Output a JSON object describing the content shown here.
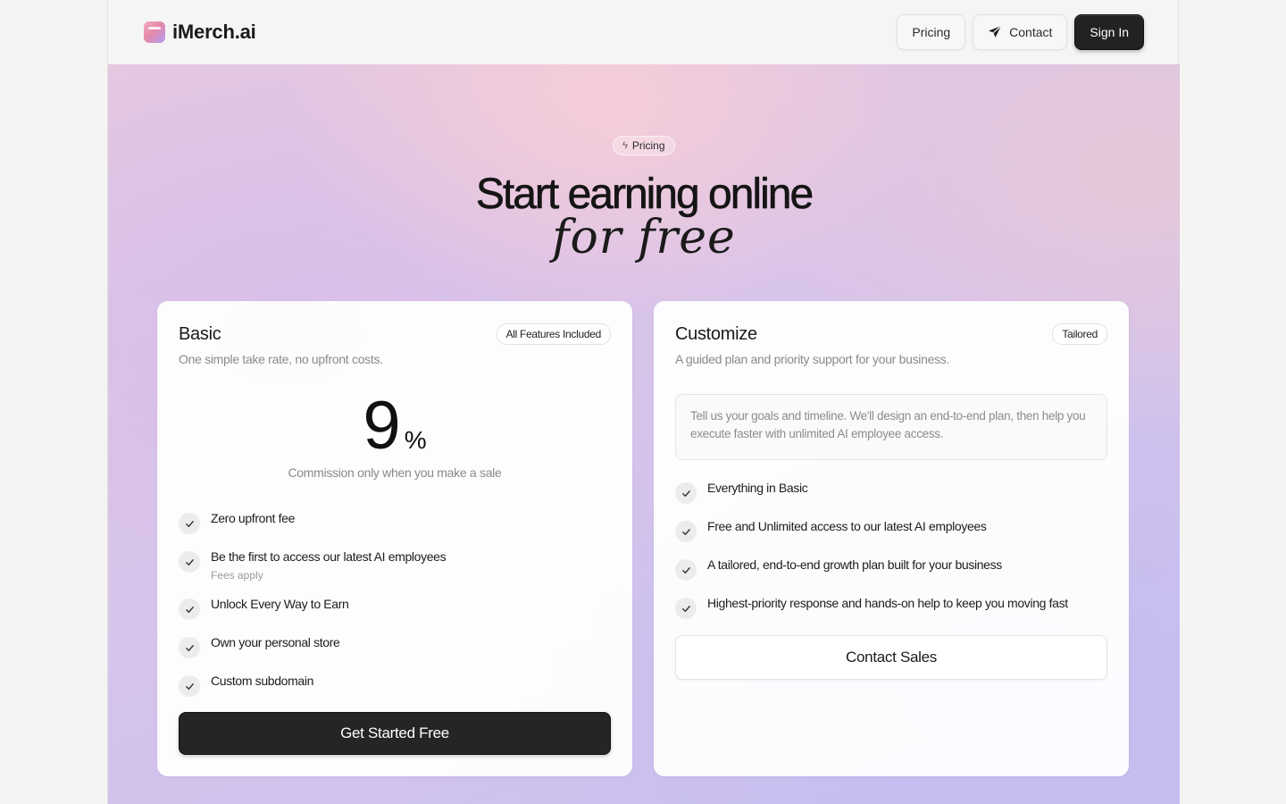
{
  "nav": {
    "brand": "iMerch.ai",
    "pricing_label": "Pricing",
    "contact_label": "Contact",
    "signin_label": "Sign In"
  },
  "hero": {
    "pill_label": "Pricing",
    "headline": "Start earning online",
    "headline_script": "for free"
  },
  "basic": {
    "title": "Basic",
    "tag": "All Features Included",
    "subtitle": "One simple take rate, no upfront costs.",
    "price": "9",
    "price_unit": "%",
    "price_caption": "Commission only when you make a sale",
    "features": [
      {
        "text": "Zero upfront fee"
      },
      {
        "text": "Be the first to access our latest AI employees",
        "note": "Fees apply"
      },
      {
        "text": "Unlock Every Way to Earn"
      },
      {
        "text": "Own your personal store"
      },
      {
        "text": "Custom subdomain"
      }
    ],
    "cta": "Get Started Free"
  },
  "custom": {
    "title": "Customize",
    "tag": "Tailored",
    "subtitle": "A guided plan and priority support for your business.",
    "description": "Tell us your goals and timeline. We'll design an end-to-end plan, then help you execute faster with unlimited AI employee access.",
    "features": [
      {
        "text": "Everything in Basic"
      },
      {
        "text": "Free and Unlimited access to our latest AI employees"
      },
      {
        "text": "A tailored, end-to-end growth plan built for your business"
      },
      {
        "text": "Highest-priority response and hands-on help to keep you moving fast"
      }
    ],
    "cta": "Contact Sales"
  }
}
